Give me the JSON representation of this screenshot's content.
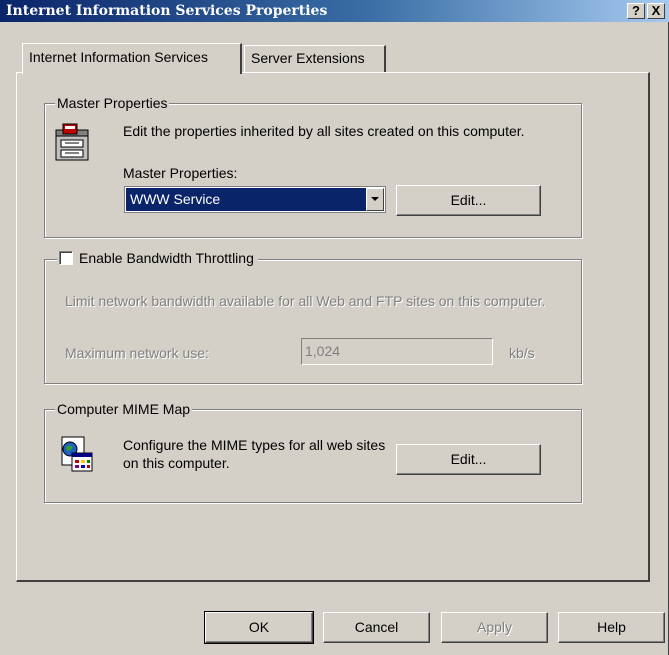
{
  "window": {
    "title": "Internet Information Services Properties",
    "help_button": "?",
    "close_button": "X"
  },
  "tabs": [
    {
      "label": "Internet Information Services",
      "active": true
    },
    {
      "label": "Server Extensions",
      "active": false
    }
  ],
  "master_properties": {
    "group_label": "Master Properties",
    "description": "Edit the properties inherited by all sites created on this computer.",
    "combo_label": "Master Properties:",
    "combo_value": "WWW Service",
    "edit_button": "Edit...",
    "icon": "server-properties-icon"
  },
  "bandwidth": {
    "checkbox_label": "Enable Bandwidth Throttling",
    "checked": false,
    "description": "Limit network bandwidth available for all Web and FTP sites on this computer.",
    "max_label": "Maximum network use:",
    "max_value": "1,024",
    "unit": "kb/s"
  },
  "mime_map": {
    "group_label": "Computer MIME Map",
    "description": "Configure the MIME types for all web sites on this computer.",
    "edit_button": "Edit...",
    "icon": "mime-map-icon"
  },
  "footer": {
    "ok": "OK",
    "cancel": "Cancel",
    "apply": "Apply",
    "help": "Help"
  },
  "colors": {
    "titlebar_start": "#0a246a",
    "titlebar_end": "#a6caf0",
    "face": "#d4d0c8",
    "selection": "#0a246a"
  }
}
